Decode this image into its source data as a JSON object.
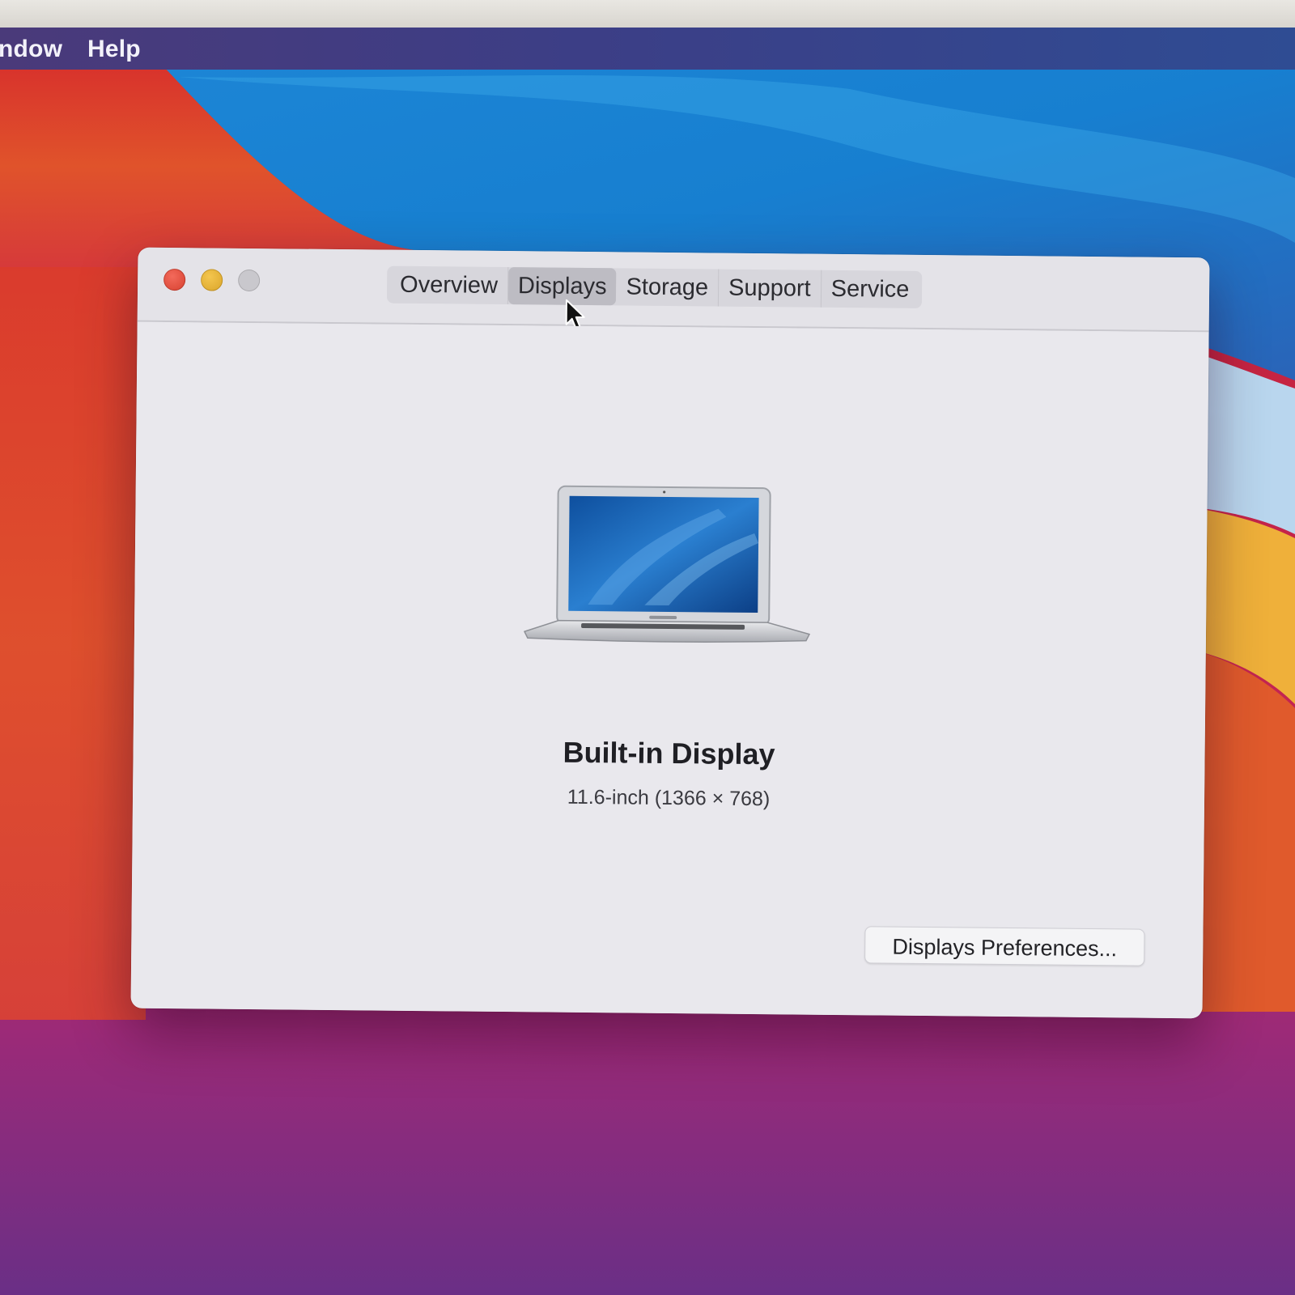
{
  "menubar": {
    "items": [
      "ndow",
      "Help"
    ]
  },
  "window": {
    "tabs": [
      {
        "label": "Overview"
      },
      {
        "label": "Displays"
      },
      {
        "label": "Storage"
      },
      {
        "label": "Support"
      },
      {
        "label": "Service"
      }
    ],
    "active_tab": "Displays",
    "display": {
      "name": "Built-in Display",
      "spec": "11.6-inch (1366 × 768)"
    },
    "preferences_button": "Displays Preferences..."
  },
  "icons": {
    "traffic_lights": [
      "close-icon",
      "minimize-icon",
      "zoom-icon"
    ],
    "laptop": "laptop-icon",
    "cursor": "mouse-cursor-icon"
  },
  "colors": {
    "close": "#e04a38",
    "minimize": "#e8b53b",
    "zoom": "#c9c8cd",
    "window_bg": "#e9e8ed",
    "active_tab": "#bdbcc3"
  }
}
